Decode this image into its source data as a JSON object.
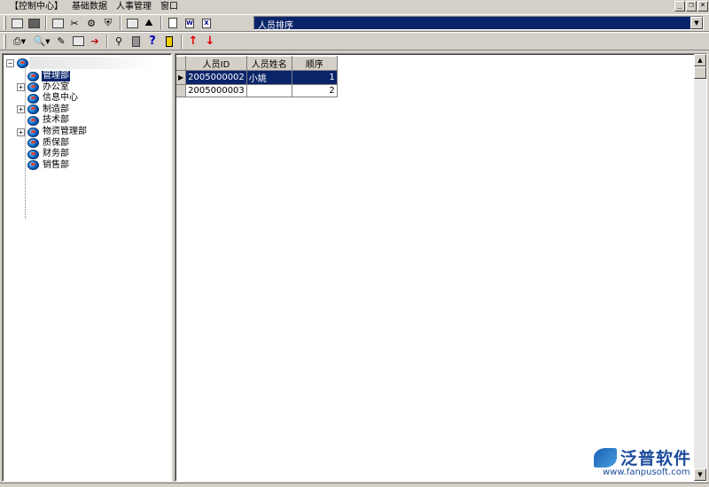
{
  "menu": [
    "【控制中心】",
    "基础数据",
    "人事管理",
    "窗口"
  ],
  "window_controls": [
    "_",
    "❐",
    "×"
  ],
  "combo": {
    "value": "人员排序"
  },
  "tree": {
    "nodes": [
      {
        "label": "管理部",
        "expandable": false,
        "selected": true
      },
      {
        "label": "办公室",
        "expandable": true,
        "selected": false
      },
      {
        "label": "信息中心",
        "expandable": false,
        "selected": false
      },
      {
        "label": "制造部",
        "expandable": true,
        "selected": false
      },
      {
        "label": "技术部",
        "expandable": false,
        "selected": false
      },
      {
        "label": "物资管理部",
        "expandable": true,
        "selected": false
      },
      {
        "label": "质保部",
        "expandable": false,
        "selected": false
      },
      {
        "label": "财务部",
        "expandable": false,
        "selected": false
      },
      {
        "label": "销售部",
        "expandable": false,
        "selected": false
      }
    ]
  },
  "grid": {
    "headers": [
      "人员ID",
      "人员姓名",
      "顺序"
    ],
    "rows": [
      {
        "id": "2005000002",
        "name": "小姚",
        "order": "1",
        "selected": true
      },
      {
        "id": "2005000003",
        "name": "",
        "order": "2",
        "selected": false
      }
    ]
  },
  "logo": {
    "name": "泛普软件",
    "url": "www.fanpusoft.com"
  }
}
